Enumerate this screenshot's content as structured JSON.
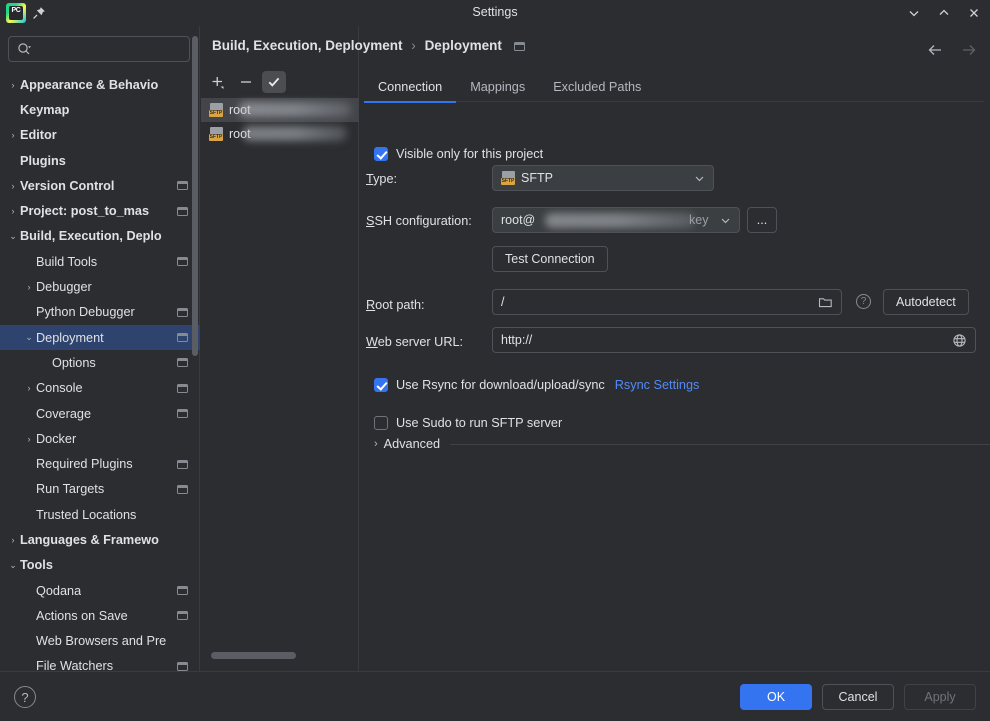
{
  "window": {
    "title": "Settings",
    "logo_text": "PC",
    "pin_icon": "pin-icon",
    "minimize_label": "⌄",
    "maximize_label": "⌃",
    "close_label": "✕"
  },
  "search": {
    "placeholder": "",
    "value": "",
    "icon": "search-icon"
  },
  "sidebar": {
    "items": [
      {
        "label": "Appearance & Behavio",
        "indent": 0,
        "arrow": "›",
        "bold": true,
        "chip": false,
        "selected": false
      },
      {
        "label": "Keymap",
        "indent": 0,
        "arrow": "",
        "bold": true,
        "chip": false,
        "selected": false
      },
      {
        "label": "Editor",
        "indent": 0,
        "arrow": "›",
        "bold": true,
        "chip": false,
        "selected": false
      },
      {
        "label": "Plugins",
        "indent": 0,
        "arrow": "",
        "bold": true,
        "chip": false,
        "selected": false
      },
      {
        "label": "Version Control",
        "indent": 0,
        "arrow": "›",
        "bold": true,
        "chip": true,
        "selected": false
      },
      {
        "label": "Project: post_to_mas",
        "indent": 0,
        "arrow": "›",
        "bold": true,
        "chip": true,
        "selected": false
      },
      {
        "label": "Build, Execution, Deplo",
        "indent": 0,
        "arrow": "⌄",
        "bold": true,
        "chip": false,
        "selected": false
      },
      {
        "label": "Build Tools",
        "indent": 1,
        "arrow": "",
        "bold": false,
        "chip": true,
        "selected": false
      },
      {
        "label": "Debugger",
        "indent": 1,
        "arrow": "›",
        "bold": false,
        "chip": false,
        "selected": false
      },
      {
        "label": "Python Debugger",
        "indent": 1,
        "arrow": "",
        "bold": false,
        "chip": true,
        "selected": false
      },
      {
        "label": "Deployment",
        "indent": 1,
        "arrow": "⌄",
        "bold": false,
        "chip": true,
        "selected": true
      },
      {
        "label": "Options",
        "indent": 2,
        "arrow": "",
        "bold": false,
        "chip": true,
        "selected": false
      },
      {
        "label": "Console",
        "indent": 1,
        "arrow": "›",
        "bold": false,
        "chip": true,
        "selected": false
      },
      {
        "label": "Coverage",
        "indent": 1,
        "arrow": "",
        "bold": false,
        "chip": true,
        "selected": false
      },
      {
        "label": "Docker",
        "indent": 1,
        "arrow": "›",
        "bold": false,
        "chip": false,
        "selected": false
      },
      {
        "label": "Required Plugins",
        "indent": 1,
        "arrow": "",
        "bold": false,
        "chip": true,
        "selected": false
      },
      {
        "label": "Run Targets",
        "indent": 1,
        "arrow": "",
        "bold": false,
        "chip": true,
        "selected": false
      },
      {
        "label": "Trusted Locations",
        "indent": 1,
        "arrow": "",
        "bold": false,
        "chip": false,
        "selected": false
      },
      {
        "label": "Languages & Framewo",
        "indent": 0,
        "arrow": "›",
        "bold": true,
        "chip": false,
        "selected": false
      },
      {
        "label": "Tools",
        "indent": 0,
        "arrow": "⌄",
        "bold": true,
        "chip": false,
        "selected": false
      },
      {
        "label": "Qodana",
        "indent": 1,
        "arrow": "",
        "bold": false,
        "chip": true,
        "selected": false
      },
      {
        "label": "Actions on Save",
        "indent": 1,
        "arrow": "",
        "bold": false,
        "chip": true,
        "selected": false
      },
      {
        "label": "Web Browsers and Pre",
        "indent": 1,
        "arrow": "",
        "bold": false,
        "chip": false,
        "selected": false
      },
      {
        "label": "File Watchers",
        "indent": 1,
        "arrow": "",
        "bold": false,
        "chip": true,
        "selected": false
      }
    ]
  },
  "server_panel": {
    "toolbar": {
      "add_label": "+",
      "remove_label": "−",
      "toggle_label": "✓"
    },
    "servers": [
      {
        "name": "root",
        "type_badge": "SFTP",
        "selected": true,
        "redacted": true
      },
      {
        "name": "root",
        "type_badge": "SFTP",
        "selected": false,
        "redacted": true
      }
    ]
  },
  "header": {
    "breadcrumb_root": "Build, Execution, Deployment",
    "breadcrumb_sep": "›",
    "breadcrumb_leaf": "Deployment",
    "back_icon": "arrow-left-icon",
    "forward_icon": "arrow-right-icon"
  },
  "tabs": [
    {
      "label": "Connection",
      "selected": true
    },
    {
      "label": "Mappings",
      "selected": false
    },
    {
      "label": "Excluded Paths",
      "selected": false
    }
  ],
  "connection": {
    "visible_only_label": "Visible only for this project",
    "visible_only_checked": true,
    "type_label": "Type:",
    "type_value": "SFTP",
    "type_badge": "SFTP",
    "ssh_label": "SSH configuration:",
    "ssh_value": "root@",
    "ssh_value_suffix": "key",
    "ssh_browse_label": "...",
    "test_connection_label": "Test Connection",
    "root_path_label": "Root path:",
    "root_path_value": "/",
    "folder_icon": "folder-icon",
    "help_icon": "question-mark-icon",
    "autodetect_label": "Autodetect",
    "web_url_label": "Web server URL:",
    "web_url_value": "http://",
    "globe_icon": "globe-icon",
    "rsync_label": "Use Rsync for download/upload/sync",
    "rsync_checked": true,
    "rsync_settings_link": "Rsync Settings",
    "sudo_label": "Use Sudo to run SFTP server",
    "sudo_checked": false,
    "advanced_label": "Advanced",
    "advanced_arrow": "›"
  },
  "footer": {
    "help_label": "?",
    "ok_label": "OK",
    "cancel_label": "Cancel",
    "apply_label": "Apply"
  },
  "colors": {
    "background": "#2b2d30",
    "accent": "#3574f0",
    "selection": "#2e436e",
    "link": "#548af7",
    "sftp_badge": "#d9a441",
    "text": "#dfe1e5",
    "muted": "#b4b8bf"
  }
}
